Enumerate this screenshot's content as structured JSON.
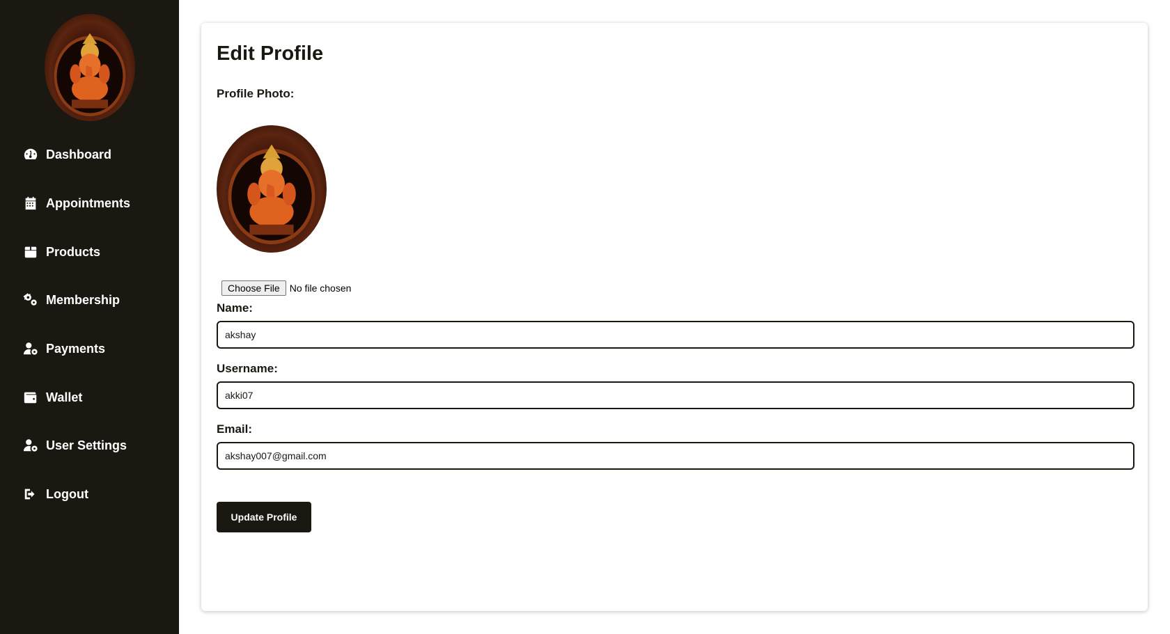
{
  "sidebar": {
    "items": [
      {
        "label": "Dashboard",
        "icon": "dashboard-gauge-icon"
      },
      {
        "label": "Appointments",
        "icon": "calendar-icon"
      },
      {
        "label": "Products",
        "icon": "box-icon"
      },
      {
        "label": "Membership",
        "icon": "gears-icon"
      },
      {
        "label": "Payments",
        "icon": "user-gear-icon"
      },
      {
        "label": "Wallet",
        "icon": "wallet-icon"
      },
      {
        "label": "User Settings",
        "icon": "user-gear-icon"
      },
      {
        "label": "Logout",
        "icon": "logout-icon"
      }
    ]
  },
  "main": {
    "title": "Edit Profile",
    "profile_photo_label": "Profile Photo:",
    "file_input": {
      "button_label": "Choose File",
      "status": "No file chosen"
    },
    "fields": {
      "name": {
        "label": "Name:",
        "value": "akshay"
      },
      "username": {
        "label": "Username:",
        "value": "akki07"
      },
      "email": {
        "label": "Email:",
        "value": "akshay007@gmail.com"
      }
    },
    "submit_label": "Update Profile"
  },
  "colors": {
    "sidebar_bg": "#1b1711",
    "button_bg": "#1b1711",
    "text_light": "#ffffff"
  }
}
